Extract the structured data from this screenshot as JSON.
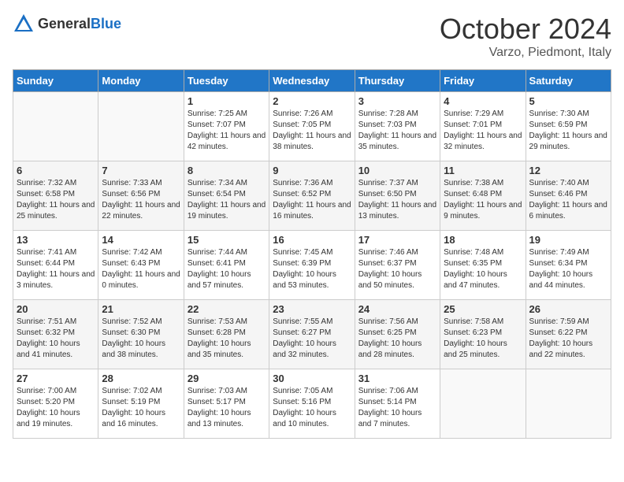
{
  "header": {
    "logo_general": "General",
    "logo_blue": "Blue",
    "month": "October 2024",
    "location": "Varzo, Piedmont, Italy"
  },
  "weekdays": [
    "Sunday",
    "Monday",
    "Tuesday",
    "Wednesday",
    "Thursday",
    "Friday",
    "Saturday"
  ],
  "weeks": [
    [
      {
        "day": "",
        "info": ""
      },
      {
        "day": "",
        "info": ""
      },
      {
        "day": "1",
        "info": "Sunrise: 7:25 AM\nSunset: 7:07 PM\nDaylight: 11 hours and 42 minutes."
      },
      {
        "day": "2",
        "info": "Sunrise: 7:26 AM\nSunset: 7:05 PM\nDaylight: 11 hours and 38 minutes."
      },
      {
        "day": "3",
        "info": "Sunrise: 7:28 AM\nSunset: 7:03 PM\nDaylight: 11 hours and 35 minutes."
      },
      {
        "day": "4",
        "info": "Sunrise: 7:29 AM\nSunset: 7:01 PM\nDaylight: 11 hours and 32 minutes."
      },
      {
        "day": "5",
        "info": "Sunrise: 7:30 AM\nSunset: 6:59 PM\nDaylight: 11 hours and 29 minutes."
      }
    ],
    [
      {
        "day": "6",
        "info": "Sunrise: 7:32 AM\nSunset: 6:58 PM\nDaylight: 11 hours and 25 minutes."
      },
      {
        "day": "7",
        "info": "Sunrise: 7:33 AM\nSunset: 6:56 PM\nDaylight: 11 hours and 22 minutes."
      },
      {
        "day": "8",
        "info": "Sunrise: 7:34 AM\nSunset: 6:54 PM\nDaylight: 11 hours and 19 minutes."
      },
      {
        "day": "9",
        "info": "Sunrise: 7:36 AM\nSunset: 6:52 PM\nDaylight: 11 hours and 16 minutes."
      },
      {
        "day": "10",
        "info": "Sunrise: 7:37 AM\nSunset: 6:50 PM\nDaylight: 11 hours and 13 minutes."
      },
      {
        "day": "11",
        "info": "Sunrise: 7:38 AM\nSunset: 6:48 PM\nDaylight: 11 hours and 9 minutes."
      },
      {
        "day": "12",
        "info": "Sunrise: 7:40 AM\nSunset: 6:46 PM\nDaylight: 11 hours and 6 minutes."
      }
    ],
    [
      {
        "day": "13",
        "info": "Sunrise: 7:41 AM\nSunset: 6:44 PM\nDaylight: 11 hours and 3 minutes."
      },
      {
        "day": "14",
        "info": "Sunrise: 7:42 AM\nSunset: 6:43 PM\nDaylight: 11 hours and 0 minutes."
      },
      {
        "day": "15",
        "info": "Sunrise: 7:44 AM\nSunset: 6:41 PM\nDaylight: 10 hours and 57 minutes."
      },
      {
        "day": "16",
        "info": "Sunrise: 7:45 AM\nSunset: 6:39 PM\nDaylight: 10 hours and 53 minutes."
      },
      {
        "day": "17",
        "info": "Sunrise: 7:46 AM\nSunset: 6:37 PM\nDaylight: 10 hours and 50 minutes."
      },
      {
        "day": "18",
        "info": "Sunrise: 7:48 AM\nSunset: 6:35 PM\nDaylight: 10 hours and 47 minutes."
      },
      {
        "day": "19",
        "info": "Sunrise: 7:49 AM\nSunset: 6:34 PM\nDaylight: 10 hours and 44 minutes."
      }
    ],
    [
      {
        "day": "20",
        "info": "Sunrise: 7:51 AM\nSunset: 6:32 PM\nDaylight: 10 hours and 41 minutes."
      },
      {
        "day": "21",
        "info": "Sunrise: 7:52 AM\nSunset: 6:30 PM\nDaylight: 10 hours and 38 minutes."
      },
      {
        "day": "22",
        "info": "Sunrise: 7:53 AM\nSunset: 6:28 PM\nDaylight: 10 hours and 35 minutes."
      },
      {
        "day": "23",
        "info": "Sunrise: 7:55 AM\nSunset: 6:27 PM\nDaylight: 10 hours and 32 minutes."
      },
      {
        "day": "24",
        "info": "Sunrise: 7:56 AM\nSunset: 6:25 PM\nDaylight: 10 hours and 28 minutes."
      },
      {
        "day": "25",
        "info": "Sunrise: 7:58 AM\nSunset: 6:23 PM\nDaylight: 10 hours and 25 minutes."
      },
      {
        "day": "26",
        "info": "Sunrise: 7:59 AM\nSunset: 6:22 PM\nDaylight: 10 hours and 22 minutes."
      }
    ],
    [
      {
        "day": "27",
        "info": "Sunrise: 7:00 AM\nSunset: 5:20 PM\nDaylight: 10 hours and 19 minutes."
      },
      {
        "day": "28",
        "info": "Sunrise: 7:02 AM\nSunset: 5:19 PM\nDaylight: 10 hours and 16 minutes."
      },
      {
        "day": "29",
        "info": "Sunrise: 7:03 AM\nSunset: 5:17 PM\nDaylight: 10 hours and 13 minutes."
      },
      {
        "day": "30",
        "info": "Sunrise: 7:05 AM\nSunset: 5:16 PM\nDaylight: 10 hours and 10 minutes."
      },
      {
        "day": "31",
        "info": "Sunrise: 7:06 AM\nSunset: 5:14 PM\nDaylight: 10 hours and 7 minutes."
      },
      {
        "day": "",
        "info": ""
      },
      {
        "day": "",
        "info": ""
      }
    ]
  ]
}
